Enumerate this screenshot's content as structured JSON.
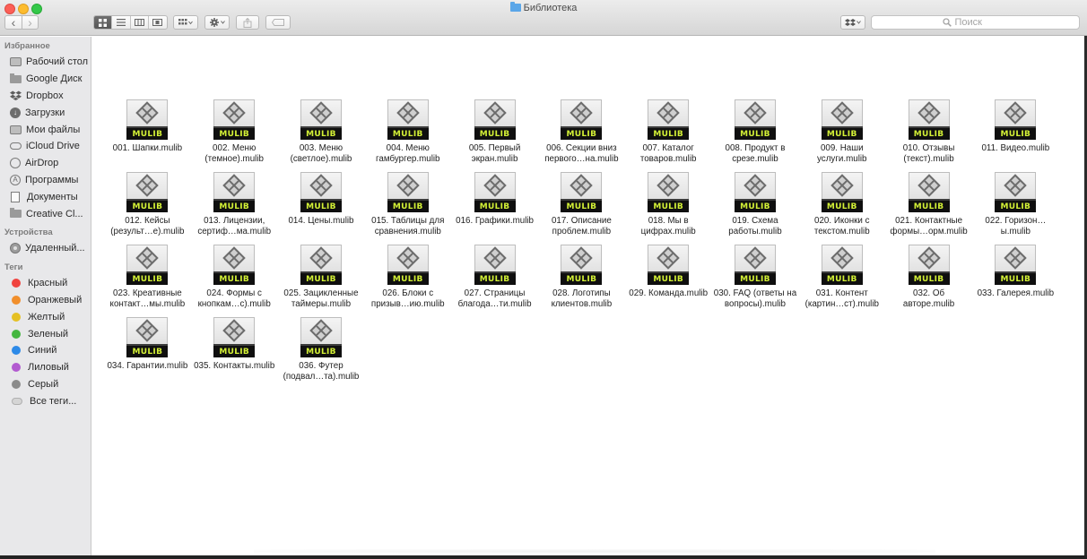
{
  "window": {
    "title": "Библиотека",
    "icons": {
      "title_folder": "folder-icon"
    }
  },
  "toolbar": {
    "back": "‹",
    "forward": "›",
    "search_placeholder": "Поиск",
    "search_icon": "magnifier-icon",
    "view_modes": [
      "icon-view",
      "list-view",
      "column-view",
      "cover-flow"
    ],
    "active_view": "icon-view"
  },
  "sidebar": {
    "favorites_header": "Избранное",
    "favorites": [
      {
        "label": "Рабочий стол",
        "icon": "desktop-icon"
      },
      {
        "label": "Google Диск",
        "icon": "folder-icon"
      },
      {
        "label": "Dropbox",
        "icon": "dropbox-icon"
      },
      {
        "label": "Загрузки",
        "icon": "downloads-icon"
      },
      {
        "label": "Мои файлы",
        "icon": "all-files-icon"
      },
      {
        "label": "iCloud Drive",
        "icon": "cloud-icon"
      },
      {
        "label": "AirDrop",
        "icon": "airdrop-icon"
      },
      {
        "label": "Программы",
        "icon": "applications-icon"
      },
      {
        "label": "Документы",
        "icon": "documents-icon"
      },
      {
        "label": "Creative Cl...",
        "icon": "folder-icon"
      }
    ],
    "devices_header": "Устройства",
    "devices": [
      {
        "label": "Удаленный...",
        "icon": "remote-disc-icon"
      }
    ],
    "tags_header": "Теги",
    "tags": [
      {
        "label": "Красный",
        "color": "#f0433f"
      },
      {
        "label": "Оранжевый",
        "color": "#f18f2c"
      },
      {
        "label": "Желтый",
        "color": "#e5c024"
      },
      {
        "label": "Зеленый",
        "color": "#45b640"
      },
      {
        "label": "Синий",
        "color": "#2d8ae8"
      },
      {
        "label": "Лиловый",
        "color": "#b25ad0"
      },
      {
        "label": "Серый",
        "color": "#8b8b8b"
      },
      {
        "label": "Все теги...",
        "color": ""
      }
    ]
  },
  "files": {
    "badge": "MULIB",
    "items": [
      "001. Шапки.mulib",
      "002. Меню (темное).mulib",
      "003. Меню (светлое).mulib",
      "004. Меню гамбургер.mulib",
      "005. Первый экран.mulib",
      "006. Секции вниз первого…на.mulib",
      "007. Каталог товаров.mulib",
      "008. Продукт в срезе.mulib",
      "009. Наши услуги.mulib",
      "010. Отзывы (текст).mulib",
      "011. Видео.mulib",
      "012. Кейсы (результ…е).mulib",
      "013. Лицензии, сертиф…ма.mulib",
      "014. Цены.mulib",
      "015. Таблицы для сравнения.mulib",
      "016. Графики.mulib",
      "017. Описание проблем.mulib",
      "018. Мы в цифрах.mulib",
      "019. Схема работы.mulib",
      "020. Иконки с текстом.mulib",
      "021. Контактные формы…орм.mulib",
      "022. Горизон…ы.mulib",
      "023. Креативные контакт…мы.mulib",
      "024. Формы с кнопкам…с).mulib",
      "025. Зацикленные таймеры.mulib",
      "026. Блоки с призыв…ию.mulib",
      "027. Страницы благода…ти.mulib",
      "028. Логотипы клиентов.mulib",
      "029. Команда.mulib",
      "030. FAQ (ответы на вопросы).mulib",
      "031. Контент (картин…ст).mulib",
      "032. Об авторе.mulib",
      "033. Галерея.mulib",
      "034. Гарантии.mulib",
      "035. Контакты.mulib",
      "036. Футер (подвал…та).mulib"
    ]
  }
}
